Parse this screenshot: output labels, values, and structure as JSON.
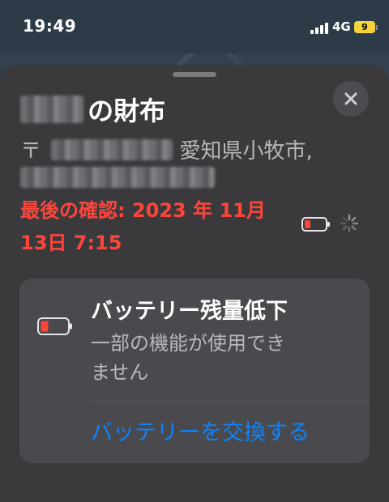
{
  "status_bar": {
    "time": "19:49",
    "network": "4G",
    "battery_level": "9"
  },
  "item": {
    "title_suffix": "の財布",
    "postal_mark": "〒",
    "address_line1_visible": "愛知県小牧市,",
    "last_seen": "最後の確認: 2023 年 11月 13日 7:15"
  },
  "battery_card": {
    "title": "バッテリー残量低下",
    "description": "一部の機能が使用できません",
    "action": "バッテリーを交換する"
  },
  "colors": {
    "accent": "#0a84ff",
    "alert": "#ff453a",
    "sheet_bg": "#3a3a3d",
    "card_bg": "#4a4a4e"
  },
  "icons": [
    "signal-icon",
    "battery-icon",
    "close-icon",
    "low-battery-icon",
    "loading-spinner-icon"
  ]
}
